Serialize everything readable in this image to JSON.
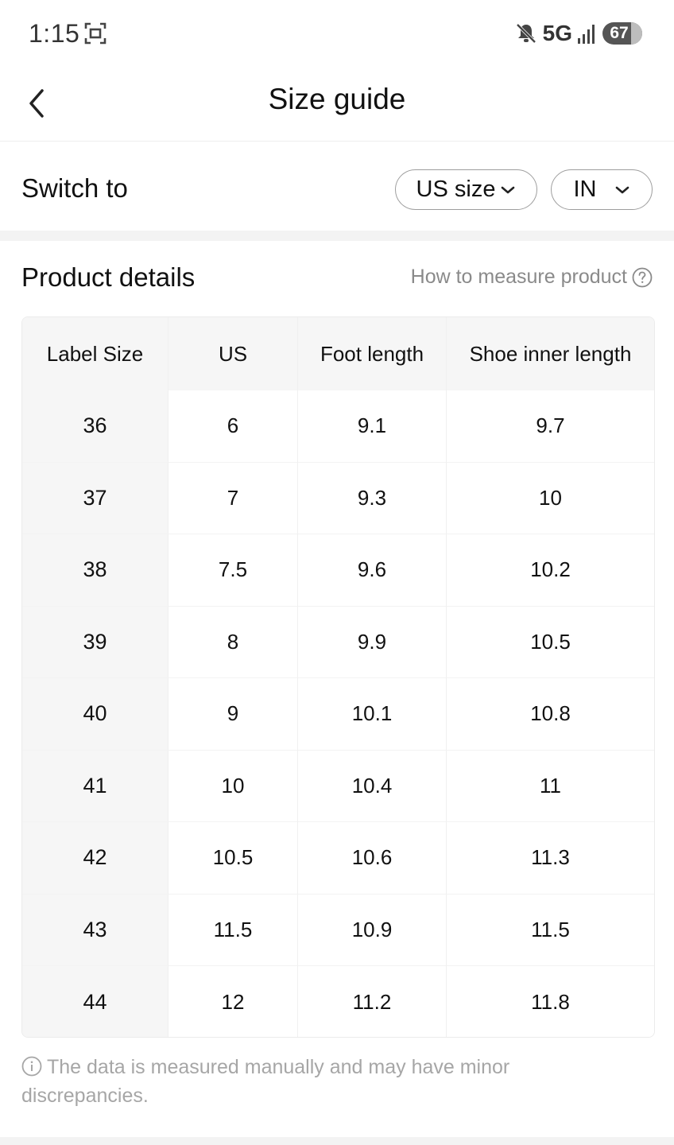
{
  "status_bar": {
    "time": "1:15",
    "network": "5G",
    "battery": "67",
    "icons": [
      "screenshot-icon",
      "mute-icon",
      "signal-icon",
      "battery-icon"
    ]
  },
  "header": {
    "title": "Size guide",
    "back_icon": "chevron-left-icon"
  },
  "switch_row": {
    "label": "Switch to",
    "size_system": "US size",
    "unit": "IN"
  },
  "product_details": {
    "title": "Product details",
    "how_to_link": "How to measure product"
  },
  "table": {
    "columns": [
      "Label Size",
      "US",
      "Foot length",
      "Shoe inner length"
    ],
    "rows": [
      [
        "36",
        "6",
        "9.1",
        "9.7"
      ],
      [
        "37",
        "7",
        "9.3",
        "10"
      ],
      [
        "38",
        "7.5",
        "9.6",
        "10.2"
      ],
      [
        "39",
        "8",
        "9.9",
        "10.5"
      ],
      [
        "40",
        "9",
        "10.1",
        "10.8"
      ],
      [
        "41",
        "10",
        "10.4",
        "11"
      ],
      [
        "42",
        "10.5",
        "10.6",
        "11.3"
      ],
      [
        "43",
        "11.5",
        "10.9",
        "11.5"
      ],
      [
        "44",
        "12",
        "11.2",
        "11.8"
      ]
    ]
  },
  "footnote": "The data is measured manually and may have minor discrepancies."
}
